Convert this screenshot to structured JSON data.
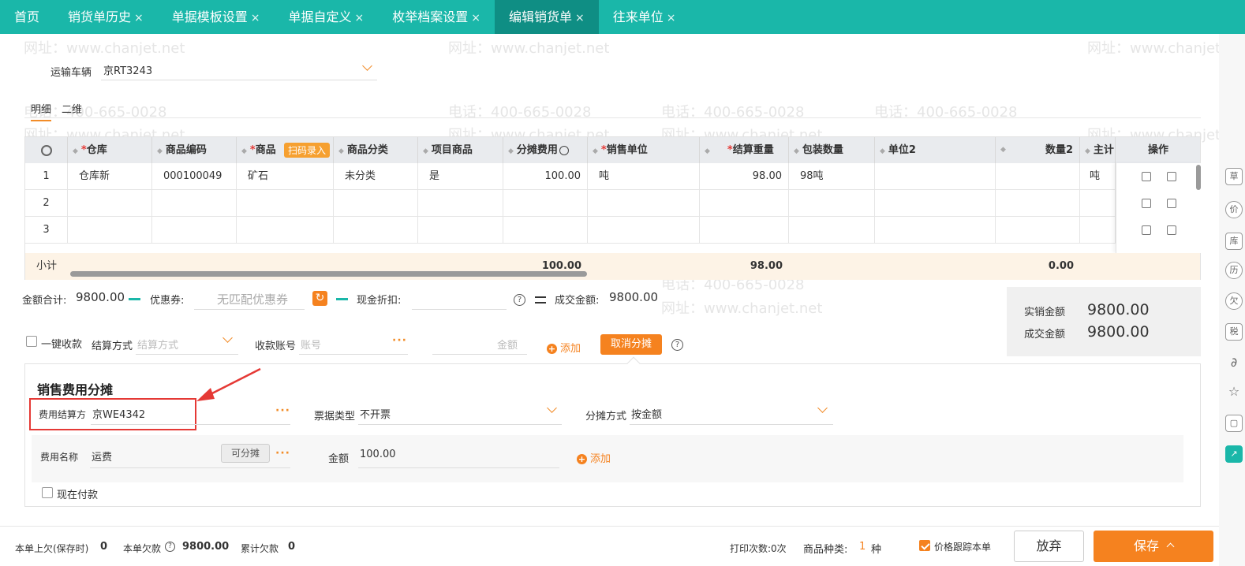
{
  "tabs": [
    {
      "label": "首页",
      "closable": false,
      "active": false
    },
    {
      "label": "销货单历史",
      "closable": true,
      "active": false
    },
    {
      "label": "单据模板设置",
      "closable": true,
      "active": false
    },
    {
      "label": "单据自定义",
      "closable": true,
      "active": false
    },
    {
      "label": "枚举档案设置",
      "closable": true,
      "active": false
    },
    {
      "label": "编辑销货单",
      "closable": true,
      "active": true
    },
    {
      "label": "往来单位",
      "closable": true,
      "active": false
    }
  ],
  "tab_close": "×",
  "watermark": {
    "phone": "电话：400-665-0028",
    "site": "网址：www.chanjet.net"
  },
  "vehicle": {
    "label": "运输车辆",
    "value": "京RT3243"
  },
  "subtabs": {
    "detail": "明细",
    "matrix": "二维"
  },
  "table": {
    "headers": {
      "warehouse": "仓库",
      "code": "商品编码",
      "product": "商品",
      "scan": "扫码录入",
      "category": "商品分类",
      "project": "项目商品",
      "alloc": "分摊费用",
      "sale_unit": "销售单位",
      "weight": "结算重量",
      "pack": "包装数量",
      "unit2": "单位2",
      "qty2": "数量2",
      "main": "主计",
      "ops": "操作"
    },
    "rows": [
      {
        "no": "1",
        "warehouse": "仓库新",
        "code": "000100049",
        "product": "矿石",
        "category": "未分类",
        "project": "是",
        "alloc": "100.00",
        "sale_unit": "吨",
        "weight": "98.00",
        "pack": "98吨",
        "unit2": "",
        "qty2": "",
        "main": "吨"
      },
      {
        "no": "2",
        "warehouse": "",
        "code": "",
        "product": "",
        "category": "",
        "project": "",
        "alloc": "",
        "sale_unit": "",
        "weight": "",
        "pack": "",
        "unit2": "",
        "qty2": "",
        "main": ""
      },
      {
        "no": "3",
        "warehouse": "",
        "code": "",
        "product": "",
        "category": "",
        "project": "",
        "alloc": "",
        "sale_unit": "",
        "weight": "",
        "pack": "",
        "unit2": "",
        "qty2": "",
        "main": ""
      }
    ],
    "subtotal": {
      "label": "小计",
      "alloc": "100.00",
      "weight": "98.00",
      "qty2": "0.00"
    }
  },
  "totals": {
    "amount_label": "金额合计:",
    "amount": "9800.00",
    "coupon_label": "优惠券:",
    "coupon_placeholder": "无匹配优惠券",
    "cash_discount_label": "现金折扣:",
    "deal_label": "成交金额:",
    "deal_amount": "9800.00"
  },
  "summary": {
    "real_label": "实销金额",
    "real": "9800.00",
    "deal_label": "成交金额",
    "deal": "9800.00"
  },
  "payment": {
    "one_click": "一键收款",
    "method_label": "结算方式",
    "method_placeholder": "结算方式",
    "account_label": "收款账号",
    "account_placeholder": "账号",
    "amount_placeholder": "金额",
    "add": "添加",
    "cancel_alloc": "取消分摊"
  },
  "expense": {
    "title": "销售费用分摊",
    "payer_label": "费用结算方",
    "payer": "京WE4342",
    "invoice_label": "票据类型",
    "invoice": "不开票",
    "method_label": "分摊方式",
    "method": "按金额",
    "name_label": "费用名称",
    "name": "运费",
    "allocatable": "可分摊",
    "amount_label": "金额",
    "amount": "100.00",
    "add": "添加",
    "pay_now": "现在付款"
  },
  "footer": {
    "prev_debt_label": "本单上欠(保存时)",
    "prev_debt": "0",
    "debt_label": "本单欠款",
    "debt": "9800.00",
    "cum_debt_label": "累计欠款",
    "cum_debt": "0",
    "print_count": "打印次数:0次",
    "kinds_label": "商品种类:",
    "kinds": "1",
    "kinds_unit": "种",
    "price_track": "价格跟踪本单",
    "discard": "放弃",
    "save": "保存"
  },
  "colors": {
    "brand": "#1ab7a9",
    "accent": "#f5821f",
    "annotation": "#e53935"
  }
}
